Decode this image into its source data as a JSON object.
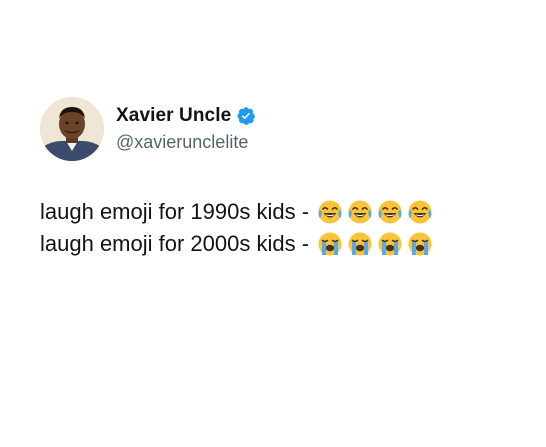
{
  "author": {
    "display_name": "Xavier Uncle",
    "handle": "@xavierunclelite",
    "verified": true,
    "verified_color": "#1d9bf0"
  },
  "tweet": {
    "lines": [
      {
        "text": "laugh emoji for 1990s kids -",
        "emoji_name": "face-with-tears-of-joy-icon",
        "emoji_char": "😂",
        "emoji_count": 4
      },
      {
        "text": "laugh emoji for 2000s kids -",
        "emoji_name": "loudly-crying-face-icon",
        "emoji_char": "😭",
        "emoji_count": 4
      }
    ]
  },
  "colors": {
    "text_primary": "#0f1419",
    "text_secondary": "#536471",
    "background": "#ffffff",
    "emoji_yellow": "#f9c33a",
    "emoji_tear": "#5aa9e6"
  }
}
